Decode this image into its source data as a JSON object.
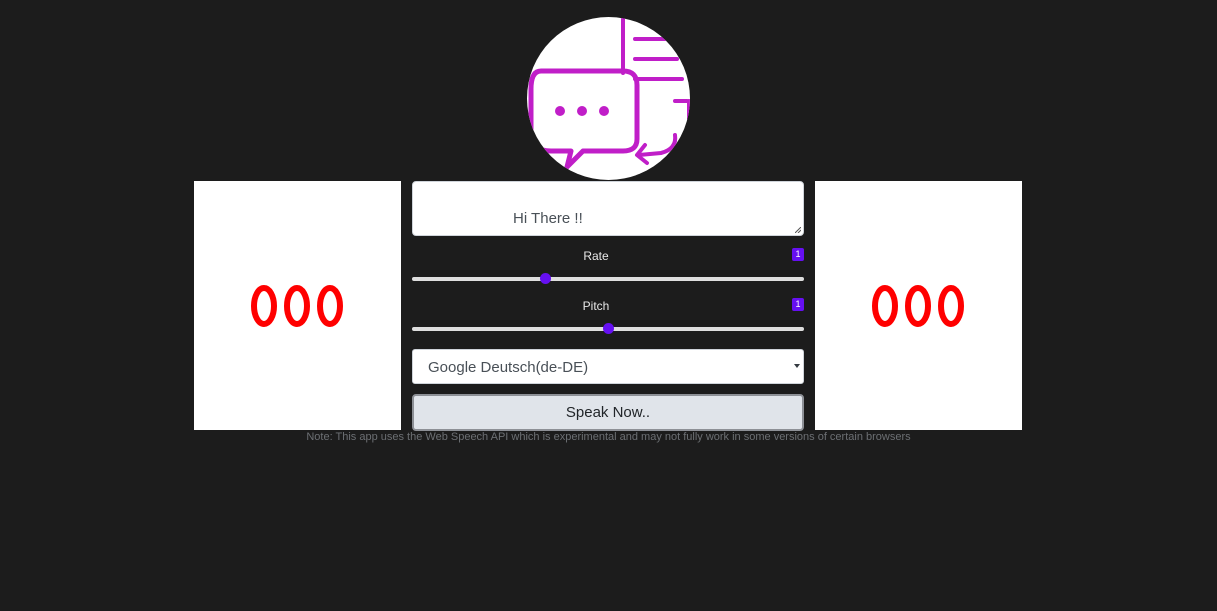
{
  "logo": {
    "icon": "chat-bubble-icon",
    "color": "#c01ec8"
  },
  "eyes": {
    "icon": "eye-icon",
    "color": "#ff0000"
  },
  "text_input": {
    "value": "Hi There !!"
  },
  "rate": {
    "label": "Rate",
    "value": "1",
    "level_fraction": 0.34
  },
  "pitch": {
    "label": "Pitch",
    "value": "1",
    "level_fraction": 0.5
  },
  "voice_select": {
    "selected": "Google Deutsch(de-DE)"
  },
  "speak_button": {
    "label": "Speak Now.."
  },
  "note": "Note: This app uses the Web Speech API which is experimental and may not fully work in some versions of certain browsers",
  "colors": {
    "accent": "#6610f2",
    "background": "#1c1c1c"
  }
}
